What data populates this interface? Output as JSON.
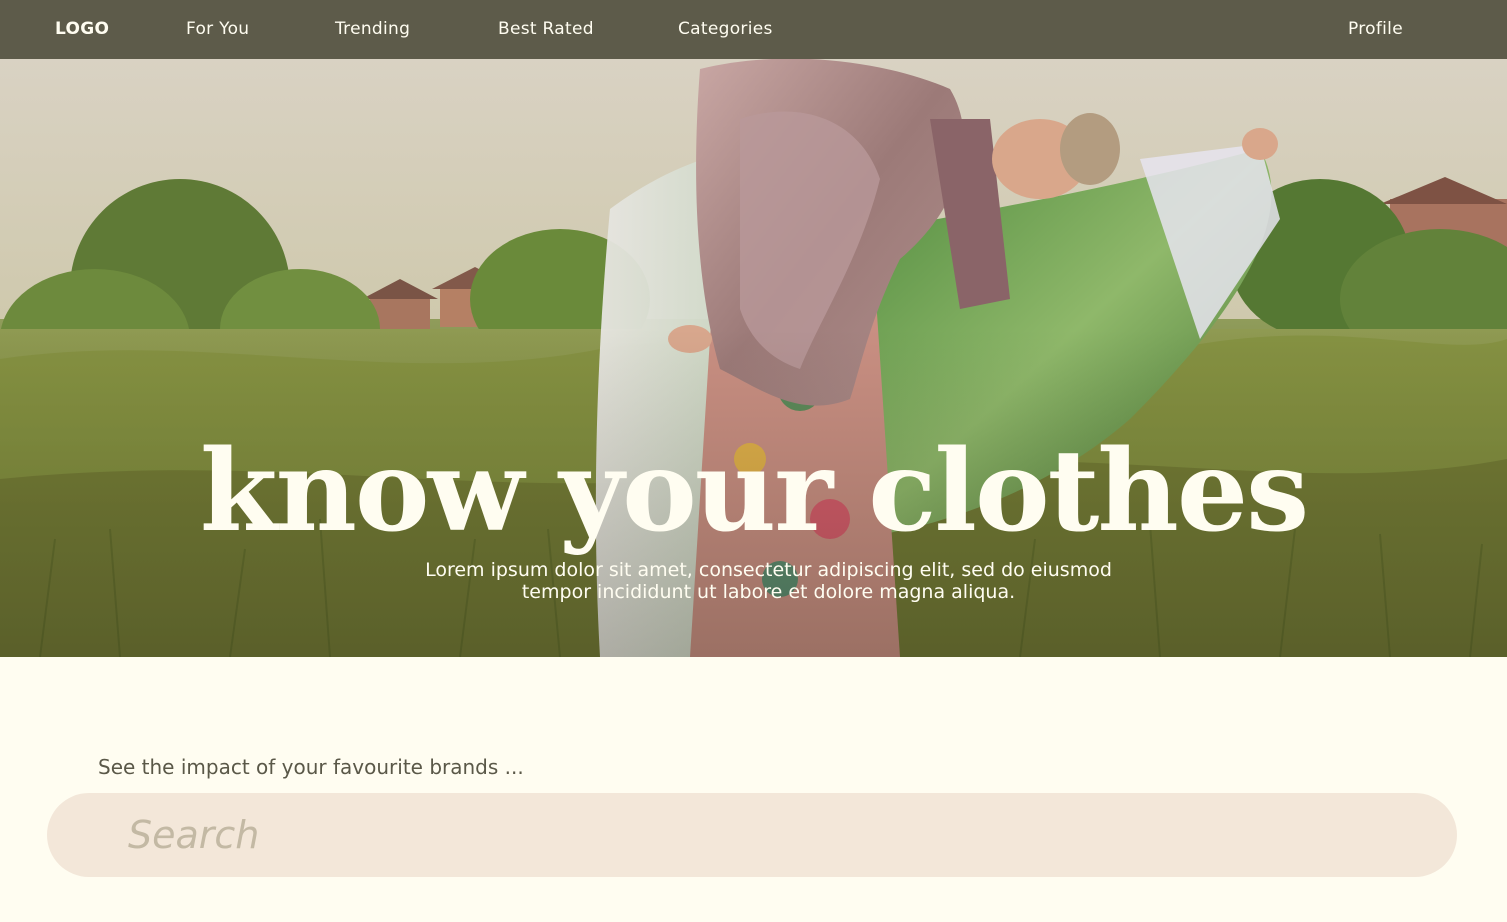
{
  "nav": {
    "logo": "LOGO",
    "links": [
      {
        "label": "For You"
      },
      {
        "label": "Trending"
      },
      {
        "label": "Best Rated"
      },
      {
        "label": "Categories"
      }
    ],
    "profile": "Profile",
    "background_color": "#5d5b4a"
  },
  "hero": {
    "title": "know your clothes",
    "subtitle": "Lorem ipsum dolor sit amet, consectetur adipiscing elit, sed do eiusmod tempor incididunt ut labore et dolore magna aliqua."
  },
  "search": {
    "caption": "See the impact of your favourite brands ...",
    "placeholder": "Search",
    "value": ""
  },
  "colors": {
    "page_background": "#fffdf1",
    "search_background": "#f3e7d9",
    "text_light": "#fffdf1",
    "text_dark": "#5a5848"
  }
}
